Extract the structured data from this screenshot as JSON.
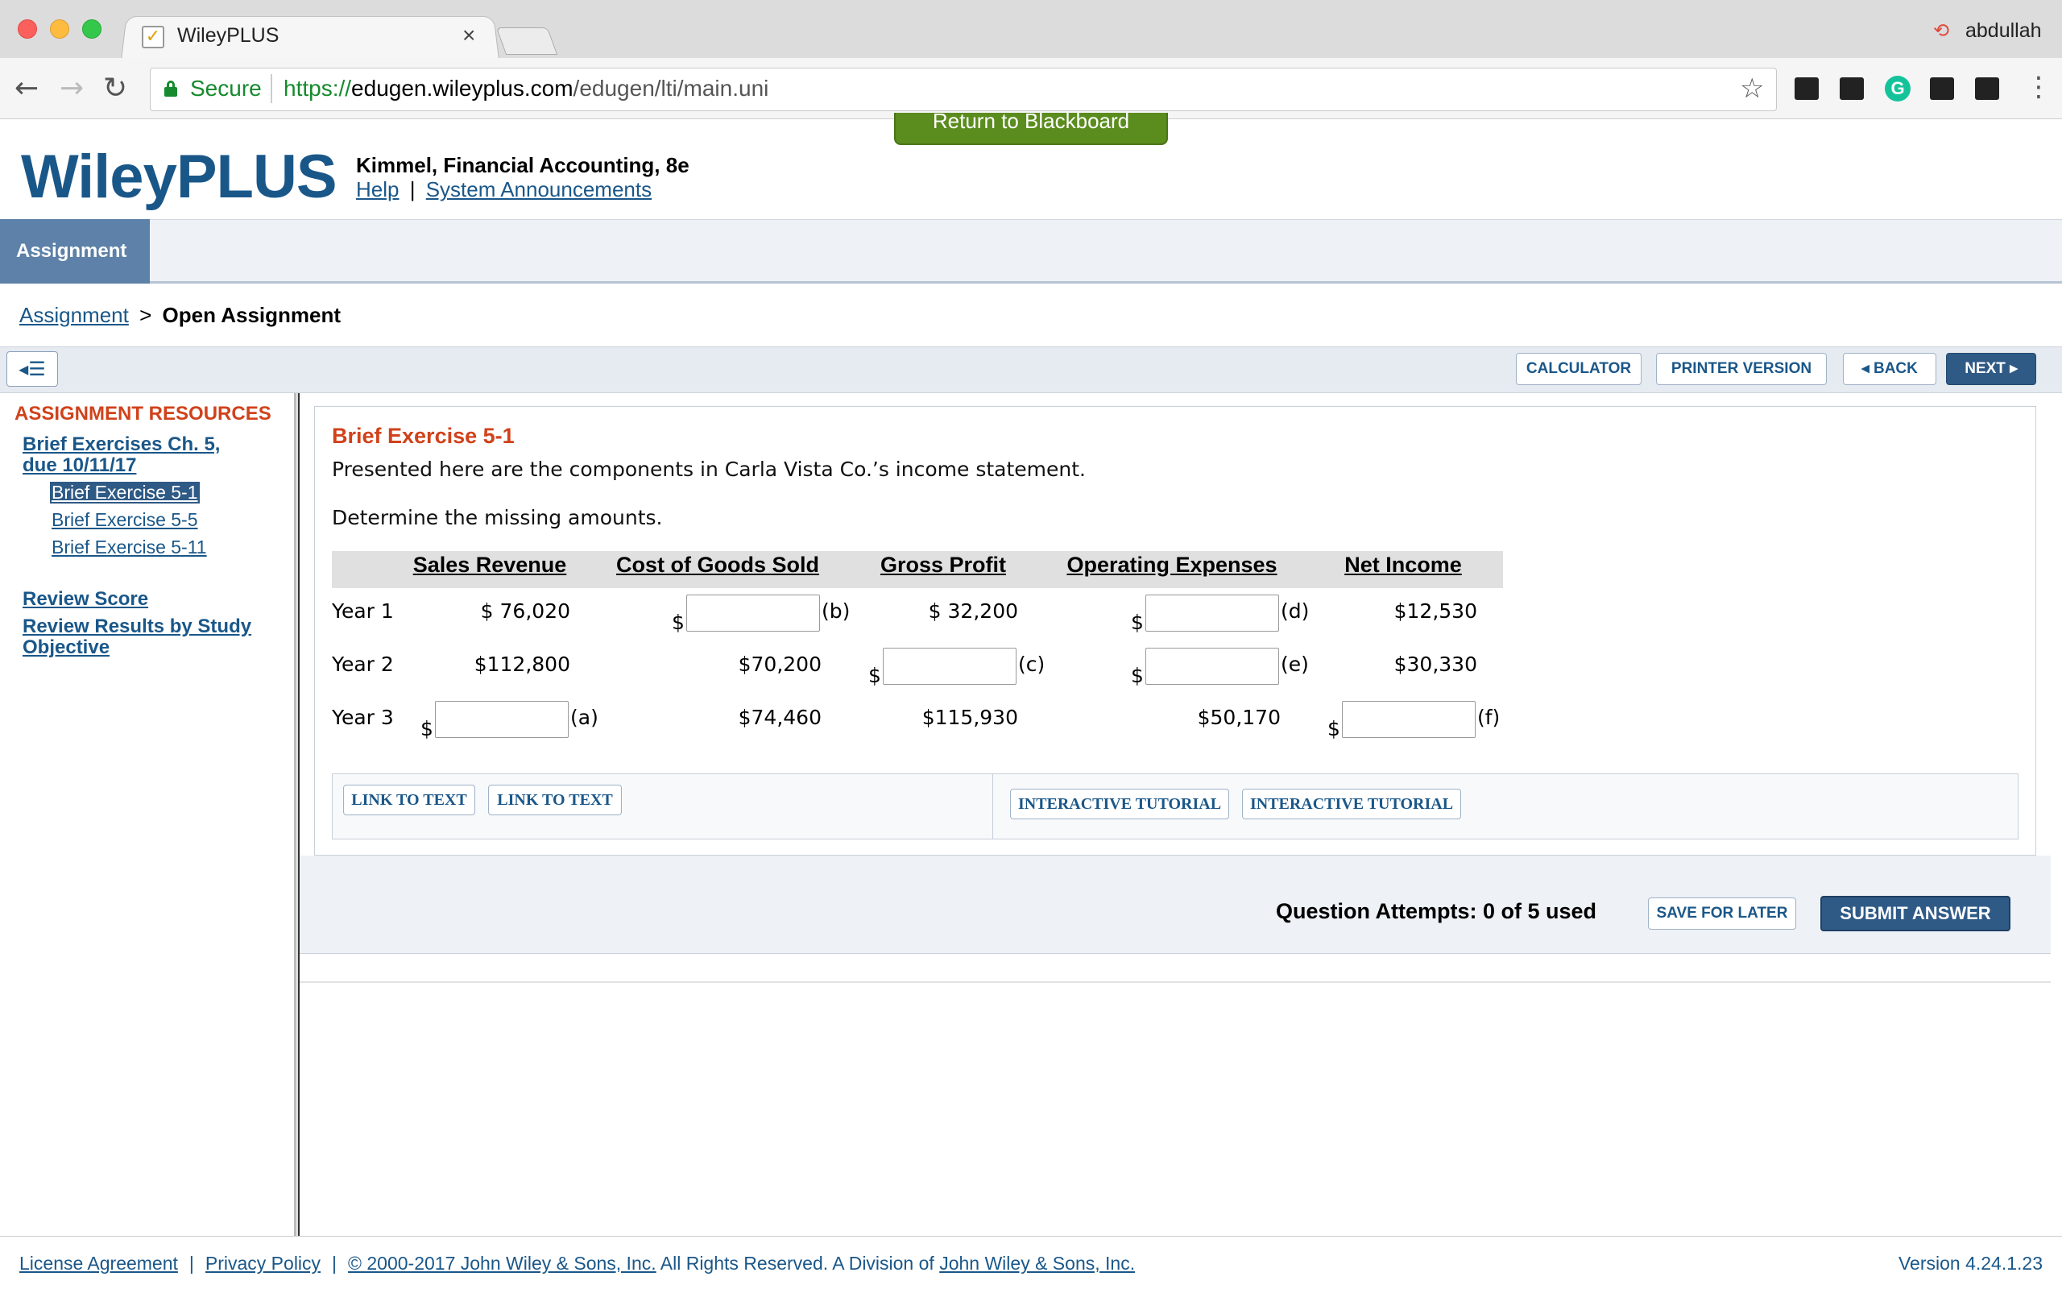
{
  "browser": {
    "tab_title": "WileyPLUS",
    "tab_close": "×",
    "user": "abdullah",
    "secure_label": "Secure",
    "url_proto": "https://",
    "url_host": "edugen.wileyplus.com",
    "url_path": "/edugen/lti/main.uni"
  },
  "header": {
    "return_label": "Return to Blackboard",
    "logo": "WileyPLUS",
    "book_title": "Kimmel, Financial Accounting, 8e",
    "help": "Help",
    "sep": "|",
    "announcements": "System Announcements"
  },
  "nav": {
    "active_tab": "Assignment"
  },
  "breadcrumb": {
    "parent": "Assignment",
    "sep": ">",
    "current": "Open Assignment"
  },
  "tools": {
    "calculator": "CALCULATOR",
    "printer": "PRINTER VERSION",
    "back": "BACK",
    "next": "NEXT"
  },
  "sidebar": {
    "heading": "ASSIGNMENT RESOURCES",
    "assignment_line1": "Brief Exercises Ch. 5,",
    "assignment_line2": "due 10/11/17",
    "items": [
      "Brief Exercise 5-1",
      "Brief Exercise 5-5",
      "Brief Exercise 5-11"
    ],
    "review_score": "Review Score",
    "review_results_line1": "Review Results by Study",
    "review_results_line2": "Objective"
  },
  "exercise": {
    "title": "Brief Exercise 5-1",
    "intro": "Presented here are the components in Carla Vista Co.’s income statement.",
    "instruction": "Determine the missing amounts.",
    "columns": [
      "Sales Revenue",
      "Cost of Goods Sold",
      "Gross Profit",
      "Operating Expenses",
      "Net Income"
    ],
    "rows": [
      {
        "label": "Year 1",
        "sales": "$ 76,020",
        "gross": "$ 32,200",
        "net": "$12,530"
      },
      {
        "label": "Year 2",
        "sales": "$112,800",
        "cogs": "$70,200",
        "net": "$30,330"
      },
      {
        "label": "Year 3",
        "cogs": "$74,460",
        "gross": "$115,930",
        "opex": "$50,170"
      }
    ],
    "dollar": "$",
    "answers": [
      "(a)",
      "(b)",
      "(c)",
      "(d)",
      "(e)",
      "(f)"
    ]
  },
  "resources": {
    "link_to_text": "LINK TO TEXT",
    "interactive_tutorial": "INTERACTIVE TUTORIAL"
  },
  "submit": {
    "attempts": "Question Attempts: 0 of 5 used",
    "save": "SAVE FOR LATER",
    "submit": "SUBMIT ANSWER"
  },
  "footer": {
    "license": "License Agreement",
    "privacy": "Privacy Policy",
    "sep": "|",
    "copyright": "© 2000-2017 John Wiley & Sons, Inc.",
    "rights": " All Rights Reserved. A Division of ",
    "company": "John Wiley & Sons, Inc.",
    "version": "Version 4.24.1.23"
  }
}
